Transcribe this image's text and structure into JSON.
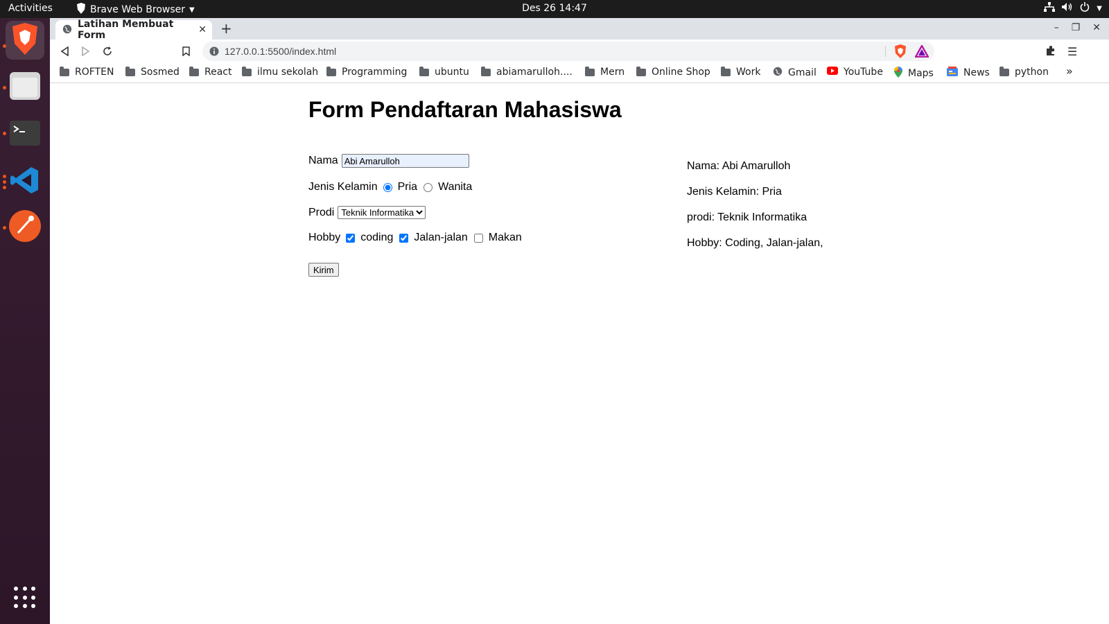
{
  "system": {
    "activities": "Activities",
    "app_name": "Brave Web Browser",
    "clock": "Des 26  14:47"
  },
  "browser": {
    "tab_title": "Latihan Membuat Form",
    "url": "127.0.0.1:5500/index.html",
    "bookmarks": [
      "ROFTEN",
      "Sosmed",
      "React",
      "ilmu sekolah",
      "Programming",
      "ubuntu",
      "abiamarulloh....",
      "Mern",
      "Online Shop",
      "Work",
      "Gmail",
      "YouTube",
      "Maps",
      "News",
      "python"
    ],
    "more_bookmarks": "»"
  },
  "form": {
    "title": "Form Pendaftaran Mahasiswa",
    "nama_label": "Nama",
    "nama_value": "Abi Amarulloh",
    "jk_label": "Jenis Kelamin",
    "jk_options": [
      "Pria",
      "Wanita"
    ],
    "jk_selected": "Pria",
    "prodi_label": "Prodi",
    "prodi_selected": "Teknik Informatika",
    "hobby_label": "Hobby",
    "hobby_options": [
      "coding",
      "Jalan-jalan",
      "Makan"
    ],
    "hobby_checked": [
      "coding",
      "Jalan-jalan"
    ],
    "submit_label": "Kirim"
  },
  "result": {
    "nama": "Nama: Abi Amarulloh",
    "jenis_kelamin": "Jenis Kelamin: Pria",
    "prodi": "prodi: Teknik Informatika",
    "hobby": "Hobby: Coding, Jalan-jalan,"
  },
  "colors": {
    "topbar": "#1c1c1c",
    "dock": "#2c1628",
    "tabbar": "#dee1e6",
    "accent": "#1a73e8",
    "brave": "#fb542b"
  }
}
